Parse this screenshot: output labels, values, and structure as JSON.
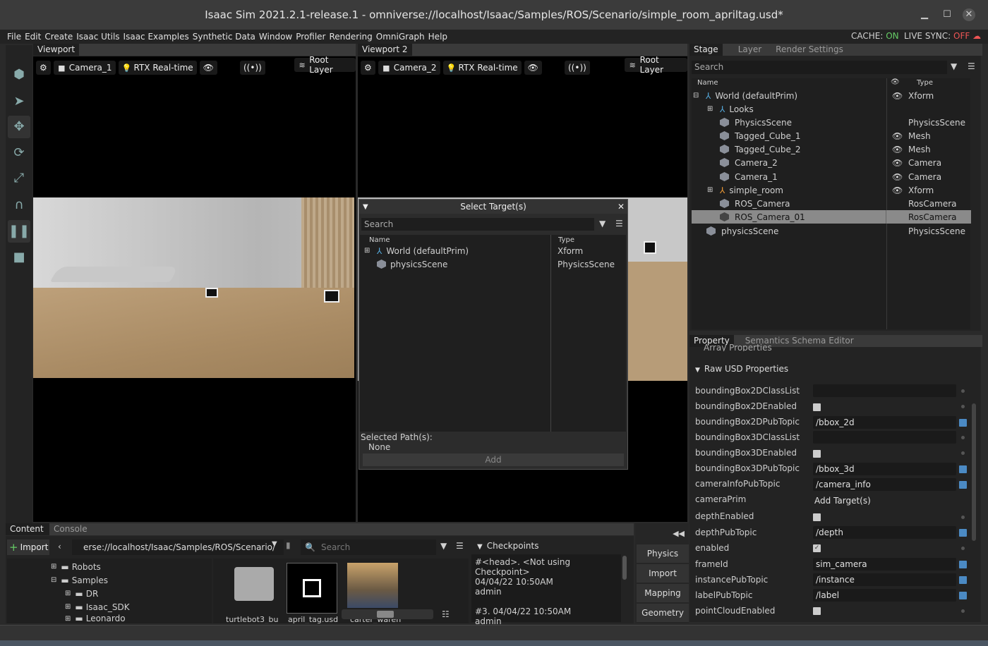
{
  "window": {
    "title": "Isaac Sim 2021.2.1-release.1 - omniverse://localhost/Isaac/Samples/ROS/Scenario/simple_room_apriltag.usd*"
  },
  "menu": [
    "File",
    "Edit",
    "Create",
    "Isaac Utils",
    "Isaac Examples",
    "Synthetic Data",
    "Window",
    "Profiler",
    "Rendering",
    "OmniGraph",
    "Help"
  ],
  "status": {
    "cache_label": "CACHE:",
    "cache_value": "ON",
    "live_label": "LIVE SYNC:",
    "live_value": "OFF"
  },
  "viewport1": {
    "tab": "Viewport",
    "camera": "Camera_1",
    "render": "RTX Real-time",
    "layer": "Root Layer"
  },
  "viewport2": {
    "tab": "Viewport 2",
    "camera": "Camera_2",
    "render": "RTX Real-time",
    "layer": "Root Layer"
  },
  "dialog": {
    "title": "Select Target(s)",
    "search_placeholder": "Search",
    "col_name": "Name",
    "col_type": "Type",
    "items": [
      {
        "name": "World (defaultPrim)",
        "type": "Xform"
      },
      {
        "name": "physicsScene",
        "type": "PhysicsScene"
      }
    ],
    "selected_label": "Selected Path(s):",
    "selected_value": "None",
    "add_button": "Add"
  },
  "stage": {
    "tabs": [
      "Stage",
      "Layer",
      "Render Settings"
    ],
    "search_placeholder": "Search",
    "col_name": "Name",
    "col_type": "Type",
    "items": [
      {
        "name": "World (defaultPrim)",
        "type": "Xform"
      },
      {
        "name": "Looks",
        "type": ""
      },
      {
        "name": "PhysicsScene",
        "type": "PhysicsScene"
      },
      {
        "name": "Tagged_Cube_1",
        "type": "Mesh"
      },
      {
        "name": "Tagged_Cube_2",
        "type": "Mesh"
      },
      {
        "name": "Camera_2",
        "type": "Camera"
      },
      {
        "name": "Camera_1",
        "type": "Camera"
      },
      {
        "name": "simple_room",
        "type": "Xform"
      },
      {
        "name": "ROS_Camera",
        "type": "RosCamera"
      },
      {
        "name": "ROS_Camera_01",
        "type": "RosCamera"
      },
      {
        "name": "physicsScene",
        "type": "PhysicsScene"
      }
    ]
  },
  "property": {
    "tabs": [
      "Property",
      "Semantics Schema Editor"
    ],
    "partial_header": "Array Properties",
    "section": "Raw USD Properties",
    "rows": [
      {
        "label": "boundingBox2DClassList",
        "value": ""
      },
      {
        "label": "boundingBox2DEnabled",
        "value": ""
      },
      {
        "label": "boundingBox2DPubTopic",
        "value": "/bbox_2d"
      },
      {
        "label": "boundingBox3DClassList",
        "value": ""
      },
      {
        "label": "boundingBox3DEnabled",
        "value": ""
      },
      {
        "label": "boundingBox3DPubTopic",
        "value": "/bbox_3d"
      },
      {
        "label": "cameraInfoPubTopic",
        "value": "/camera_info"
      },
      {
        "label": "cameraPrim",
        "value": "Add Target(s)"
      },
      {
        "label": "depthEnabled",
        "value": ""
      },
      {
        "label": "depthPubTopic",
        "value": "/depth"
      },
      {
        "label": "enabled",
        "value": "✓"
      },
      {
        "label": "frameId",
        "value": "sim_camera"
      },
      {
        "label": "instancePubTopic",
        "value": "/instance"
      },
      {
        "label": "labelPubTopic",
        "value": "/label"
      },
      {
        "label": "pointCloudEnabled",
        "value": ""
      }
    ]
  },
  "content": {
    "tabs": [
      "Content",
      "Console"
    ],
    "import_label": "Import",
    "path": "erse://localhost/Isaac/Samples/ROS/Scenario/",
    "search_placeholder": "Search",
    "tree": [
      "Robots",
      "Samples",
      "DR",
      "Isaac_SDK",
      "Leonardo"
    ],
    "files": [
      "turtlebot3_bu",
      "april_tag.usd",
      "carter_wareh"
    ]
  },
  "checkpoints": {
    "title": "Checkpoints",
    "entries": [
      {
        "line1": "#<head>.   <Not using Checkpoint>",
        "line2": "04/04/22 10:50AM",
        "line3": "admin"
      },
      {
        "line1": "#3.   04/04/22 10:50AM",
        "line2": "admin",
        "line3": ""
      }
    ]
  },
  "side_buttons": [
    "Physics",
    "Import",
    "Mapping",
    "Geometry"
  ]
}
